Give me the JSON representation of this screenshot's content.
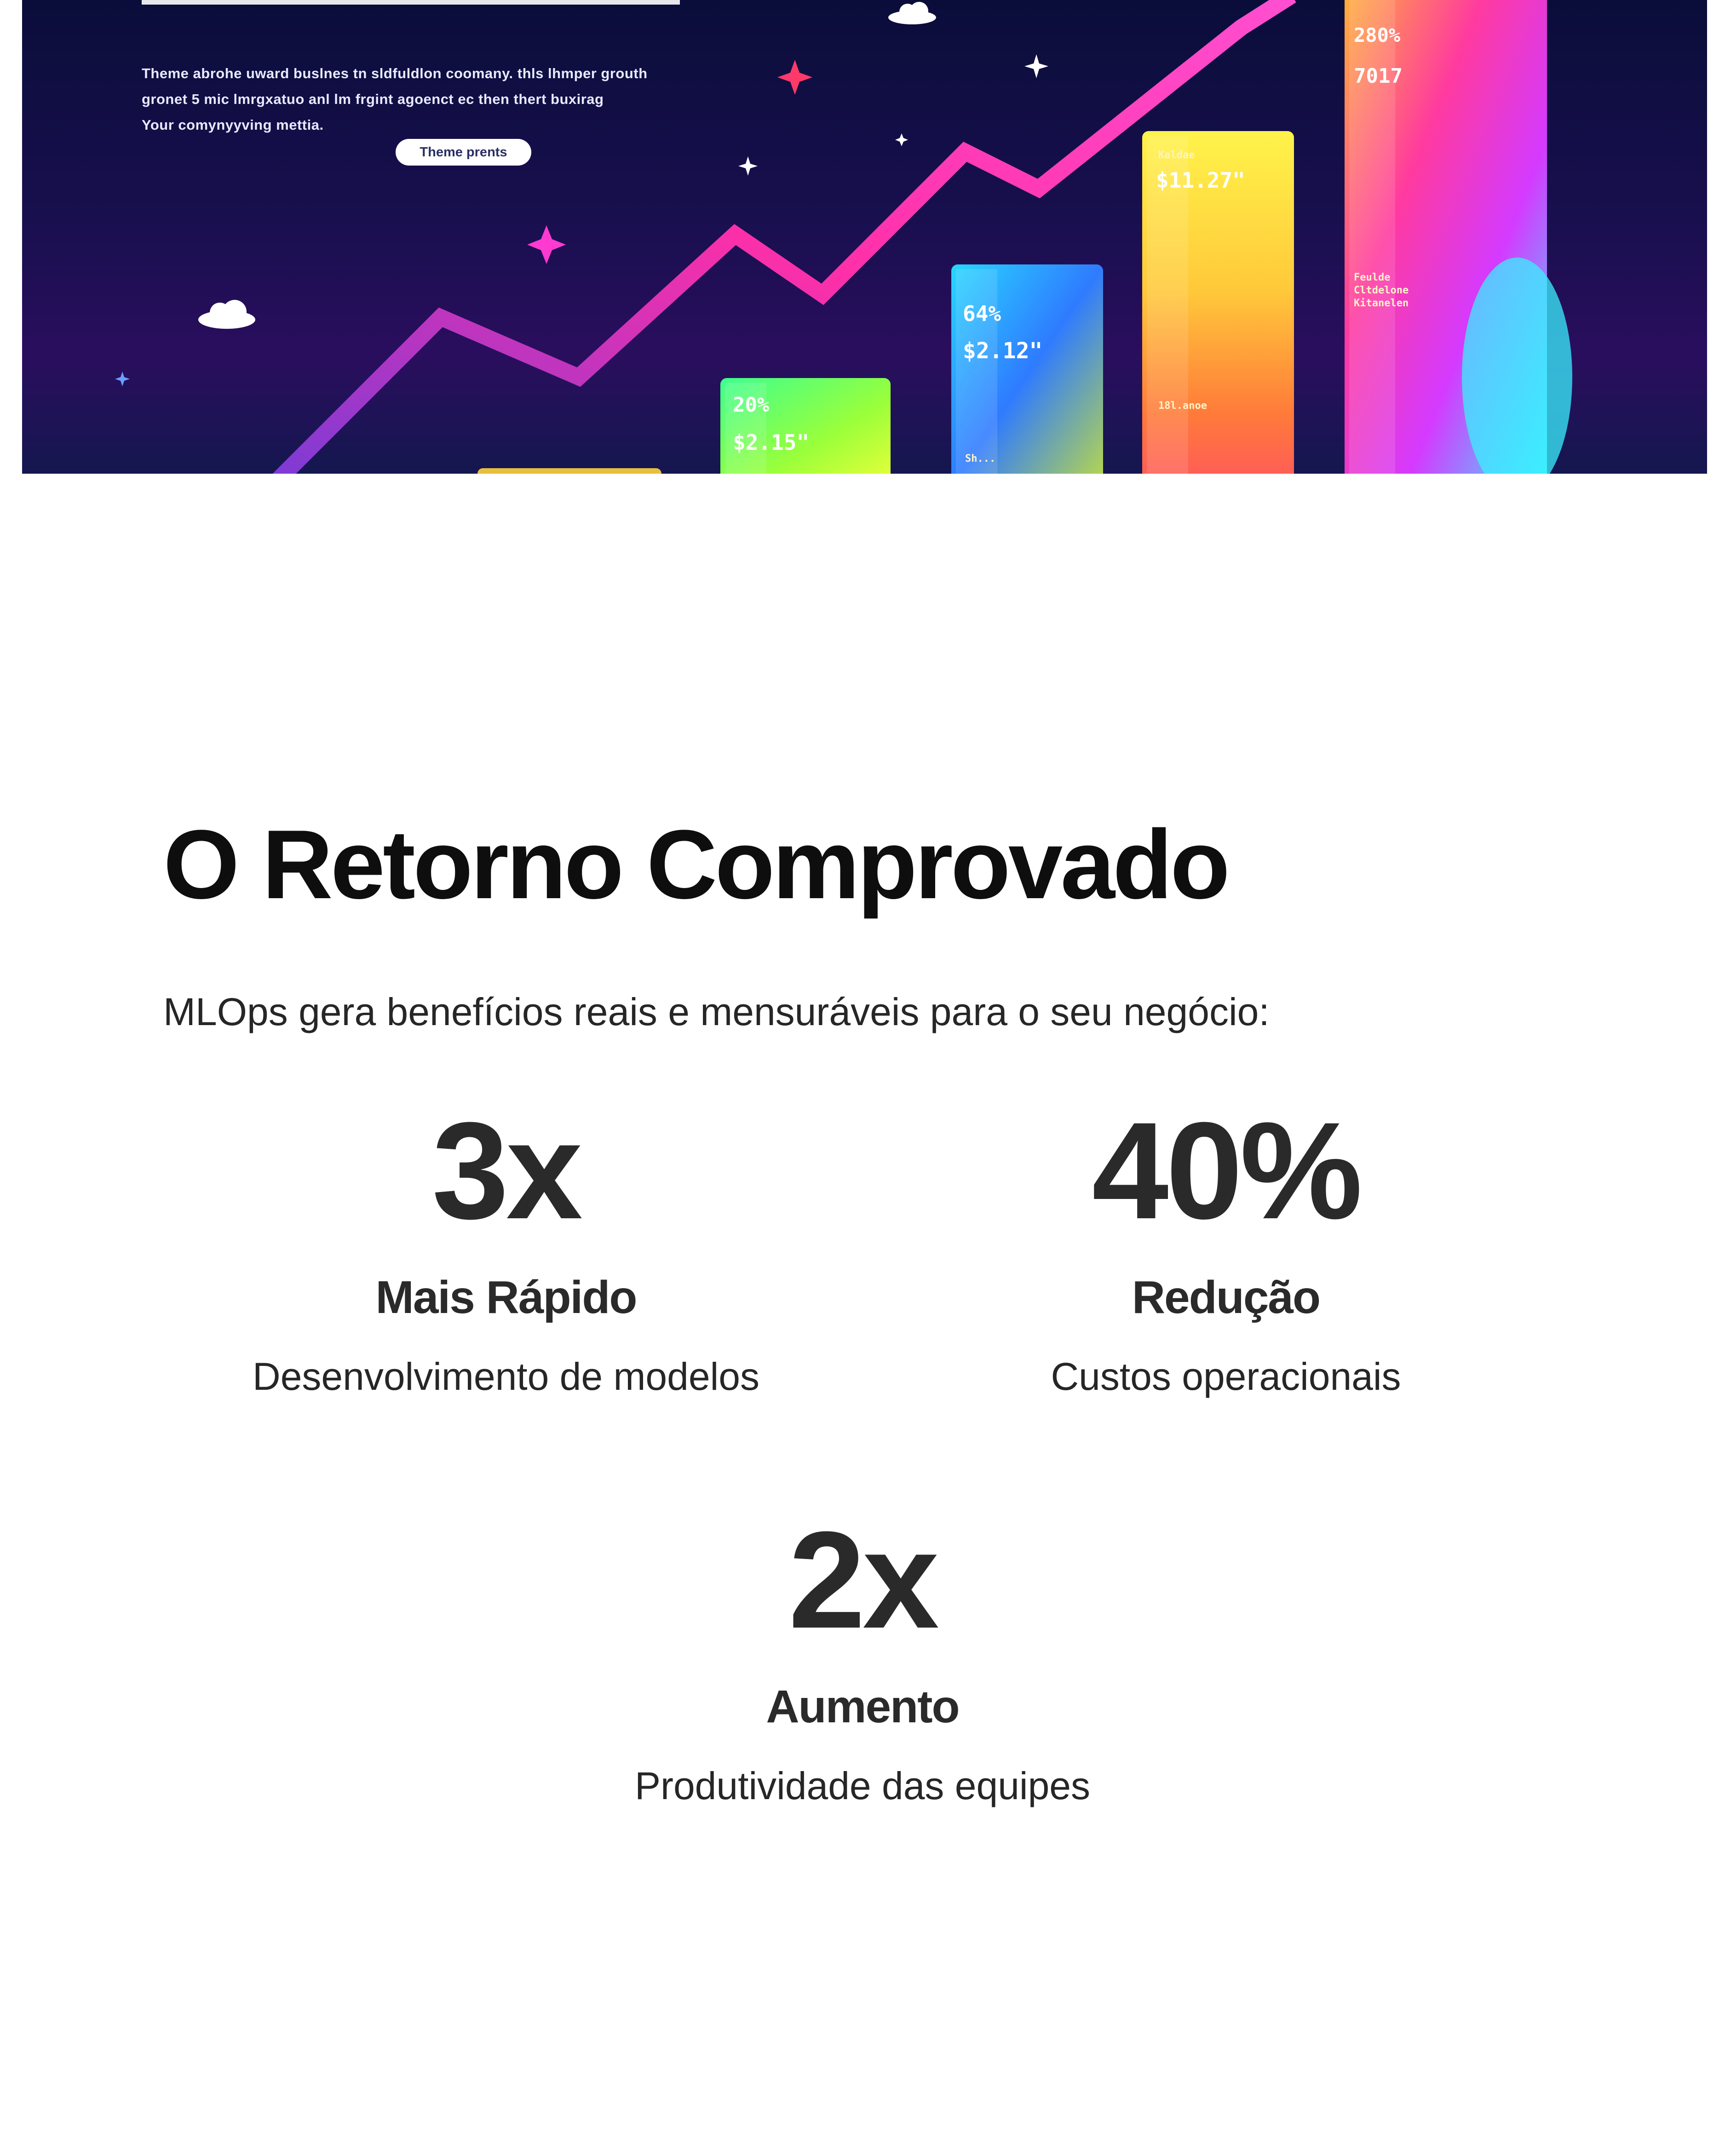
{
  "hero": {
    "paragraph_lines": [
      "Theme abrohe uward buslnes tn sldfuldlon coomany. thls lhmper grouth",
      "gronet 5 mic lmrgxatuo anl lm frgint agoenct ec then thert buxirag",
      "Your comynyyving mettia."
    ],
    "pill_label": "Theme prents",
    "bars": [
      {
        "pct": "20%",
        "amount": "$2.15\"",
        "sub": ""
      },
      {
        "pct": "64%",
        "amount": "$2.12\"",
        "sub": "Sh..."
      },
      {
        "pct": "Kaldae",
        "amount": "$11.27\"",
        "sub": "18l.anoe"
      },
      {
        "pct": "280%",
        "amount": "7017",
        "sub": "Feulde Cltdelone Kitanelen"
      }
    ],
    "colors": {
      "background_top": "#0a0d3a",
      "line_pink": "#ff2fa8",
      "line_purple": "#a23bd6"
    }
  },
  "section": {
    "title": "O Retorno Comprovado",
    "intro": "MLOps gera benefícios reais e mensuráveis para o seu negócio:"
  },
  "stats": [
    {
      "value": "3x",
      "title": "Mais Rápido",
      "description": "Desenvolvimento de modelos"
    },
    {
      "value": "40%",
      "title": "Redução",
      "description": "Custos operacionais"
    },
    {
      "value": "2x",
      "title": "Aumento",
      "description": "Produtividade das equipes"
    }
  ]
}
